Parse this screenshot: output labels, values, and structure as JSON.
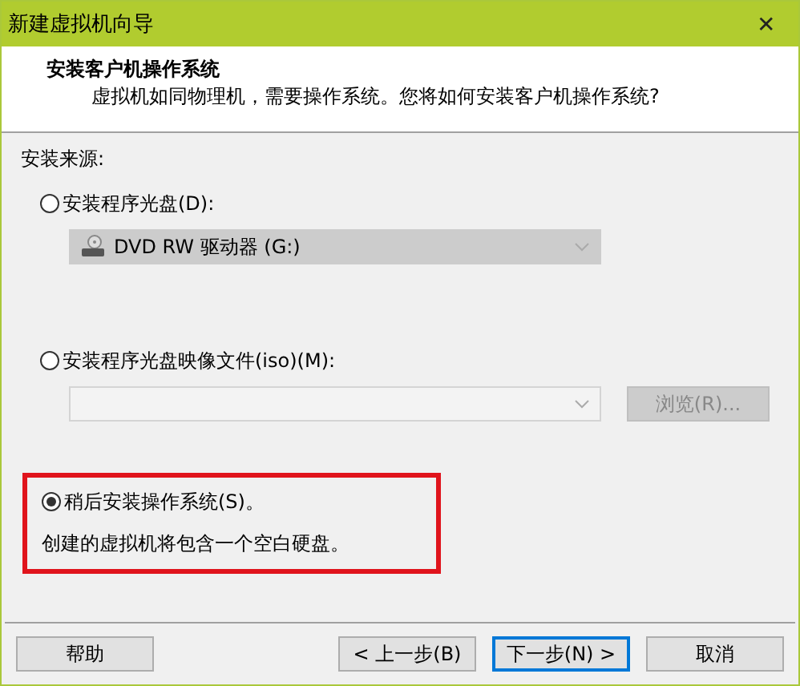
{
  "window": {
    "title": "新建虚拟机向导",
    "close": "✕"
  },
  "header": {
    "title": "安装客户机操作系统",
    "subtitle": "虚拟机如同物理机，需要操作系统。您将如何安装客户机操作系统?"
  },
  "source_label": "安装来源:",
  "options": [
    {
      "kind": "drive",
      "label": "安装程序光盘(D):",
      "selected": false,
      "highlighted": false,
      "dropdown": {
        "value": "DVD RW 驱动器 (G:)",
        "disabled": true
      }
    },
    {
      "kind": "iso",
      "label": "安装程序光盘映像文件(iso)(M):",
      "selected": false,
      "highlighted": false,
      "field": {
        "disabled": true
      },
      "browse": {
        "label": "浏览(R)...",
        "disabled": true
      }
    },
    {
      "kind": "later",
      "label": "稍后安装操作系统(S)。",
      "selected": true,
      "highlighted": true,
      "description": "创建的虚拟机将包含一个空白硬盘。"
    }
  ],
  "buttons": [
    {
      "label": "帮助",
      "focused": false
    },
    {
      "label": "< 上一步(B)",
      "focused": false
    },
    {
      "label": "下一步(N) >",
      "focused": true
    },
    {
      "label": "取消",
      "focused": false
    }
  ]
}
